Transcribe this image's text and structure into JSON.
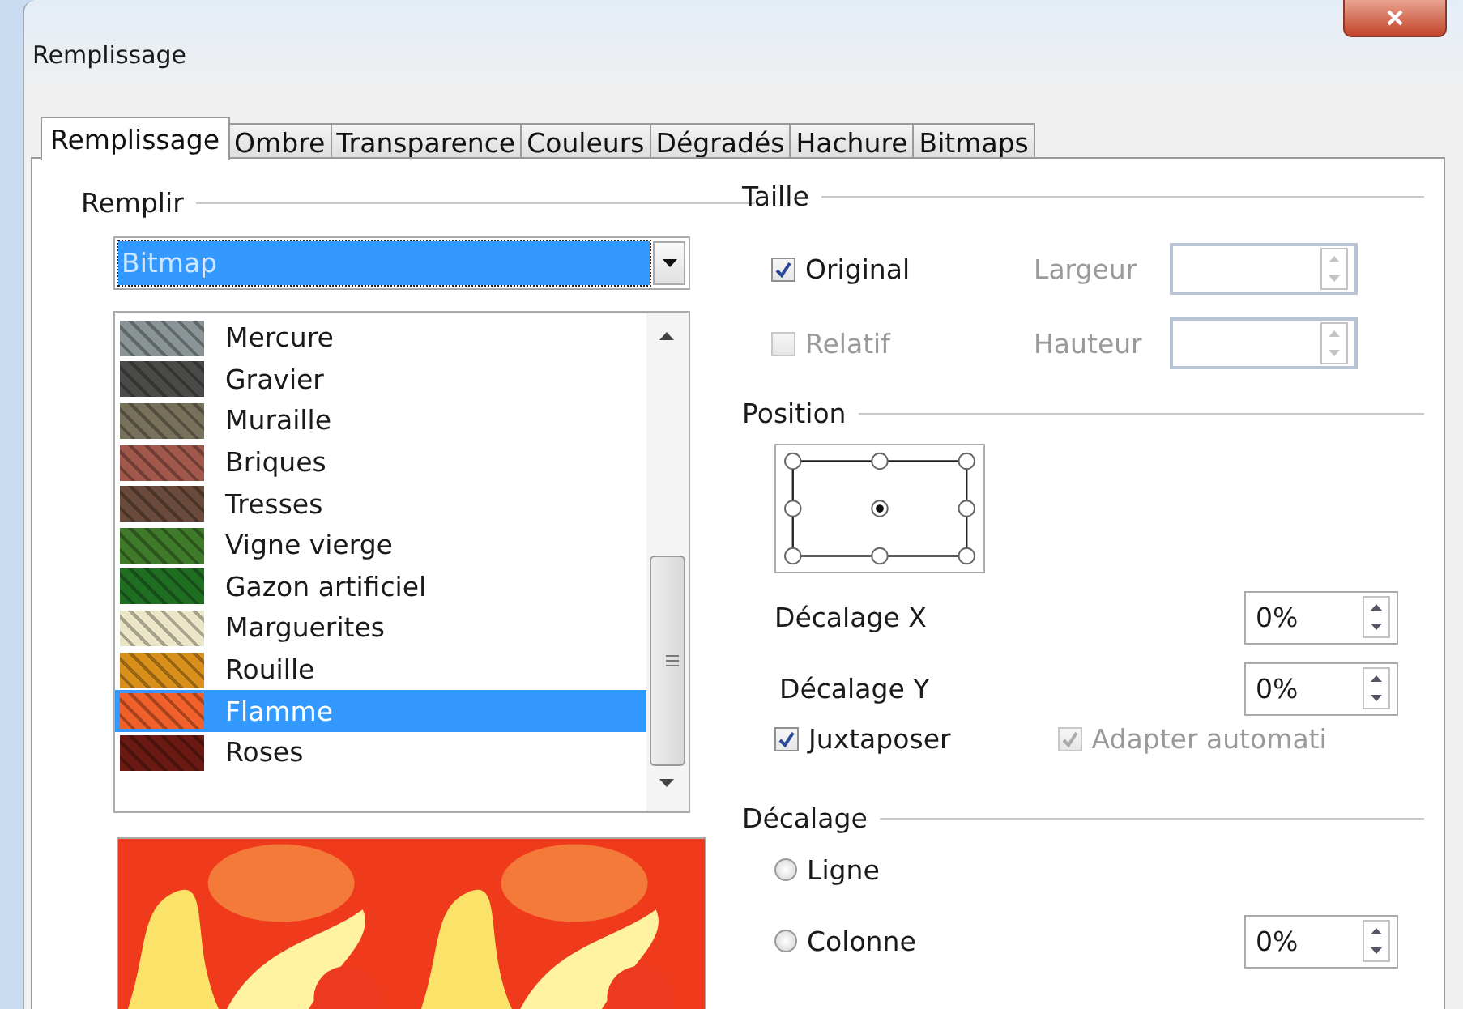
{
  "window": {
    "title": "Remplissage"
  },
  "tabs": [
    {
      "label": "Remplissage",
      "selected": true
    },
    {
      "label": "Ombre",
      "selected": false
    },
    {
      "label": "Transparence",
      "selected": false
    },
    {
      "label": "Couleurs",
      "selected": false
    },
    {
      "label": "Dégradés",
      "selected": false
    },
    {
      "label": "Hachure",
      "selected": false
    },
    {
      "label": "Bitmaps",
      "selected": false
    }
  ],
  "fill": {
    "legend": "Remplir",
    "dropdown": {
      "value": "Bitmap"
    },
    "bitmaps": [
      {
        "label": "Mercure",
        "color": "#8a9396",
        "selected": false
      },
      {
        "label": "Gravier",
        "color": "#4a4a48",
        "selected": false
      },
      {
        "label": "Muraille",
        "color": "#77705a",
        "selected": false
      },
      {
        "label": "Briques",
        "color": "#a0584a",
        "selected": false
      },
      {
        "label": "Tresses",
        "color": "#6a4a3a",
        "selected": false
      },
      {
        "label": "Vigne vierge",
        "color": "#3f7a2a",
        "selected": false
      },
      {
        "label": "Gazon artificiel",
        "color": "#1f6e22",
        "selected": false
      },
      {
        "label": "Marguerites",
        "color": "#ece6c8",
        "selected": false
      },
      {
        "label": "Rouille",
        "color": "#d8901a",
        "selected": false
      },
      {
        "label": "Flamme",
        "color": "#f0602a",
        "selected": true
      },
      {
        "label": "Roses",
        "color": "#6a1a12",
        "selected": false
      }
    ]
  },
  "size": {
    "legend": "Taille",
    "original": {
      "label": "Original",
      "checked": true,
      "disabled": false
    },
    "relative": {
      "label": "Relatif",
      "checked": false,
      "disabled": true
    },
    "width": {
      "label": "Largeur",
      "disabled": true
    },
    "height": {
      "label": "Hauteur",
      "disabled": true
    }
  },
  "position": {
    "legend": "Position",
    "points": [
      {
        "selected": false
      },
      {
        "selected": false
      },
      {
        "selected": false
      },
      {
        "selected": false
      },
      {
        "selected": true
      },
      {
        "selected": false
      },
      {
        "selected": false
      },
      {
        "selected": false
      },
      {
        "selected": false
      }
    ],
    "offset_x": {
      "label": "Décalage X",
      "value": "0%"
    },
    "offset_y": {
      "label": "Décalage Y",
      "value": "0%"
    },
    "tile": {
      "label": "Juxtaposer",
      "checked": true,
      "disabled": false
    },
    "autofit": {
      "label": "Adapter automati",
      "checked": true,
      "disabled": true
    }
  },
  "offset": {
    "legend": "Décalage",
    "row": {
      "label": "Ligne",
      "selected": false
    },
    "column": {
      "label": "Colonne",
      "selected": false
    },
    "value": "0%"
  }
}
